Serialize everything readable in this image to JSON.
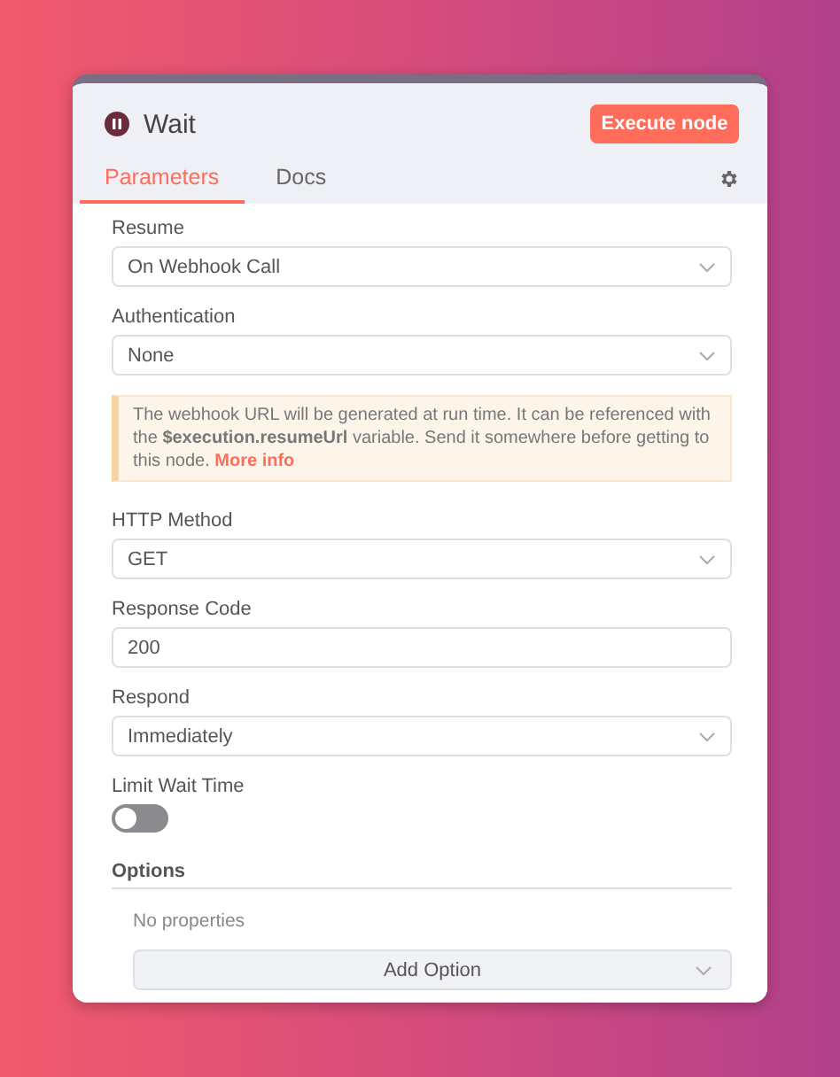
{
  "node": {
    "title": "Wait",
    "execute_button": "Execute node"
  },
  "tabs": [
    {
      "label": "Parameters",
      "selected": true
    },
    {
      "label": "Docs",
      "selected": false
    }
  ],
  "parameters": [
    {
      "kind": "select",
      "label": "Resume",
      "value": "On Webhook Call"
    },
    {
      "kind": "select",
      "label": "Authentication",
      "value": "None"
    },
    {
      "kind": "notice",
      "text": "The webhook URL will be generated at run time. It can be referenced with the **$execution.resumeUrl** variable. Send it somewhere before getting to this node.",
      "link": "More info"
    },
    {
      "kind": "select",
      "label": "HTTP Method",
      "value": "GET"
    },
    {
      "kind": "input",
      "label": "Response Code",
      "value": "200"
    },
    {
      "kind": "select",
      "label": "Respond",
      "value": "Immediately"
    },
    {
      "kind": "toggle",
      "label": "Limit Wait Time",
      "on": false
    }
  ],
  "options": {
    "title": "Options",
    "empty_text": "No properties",
    "add_button": "Add Option"
  }
}
